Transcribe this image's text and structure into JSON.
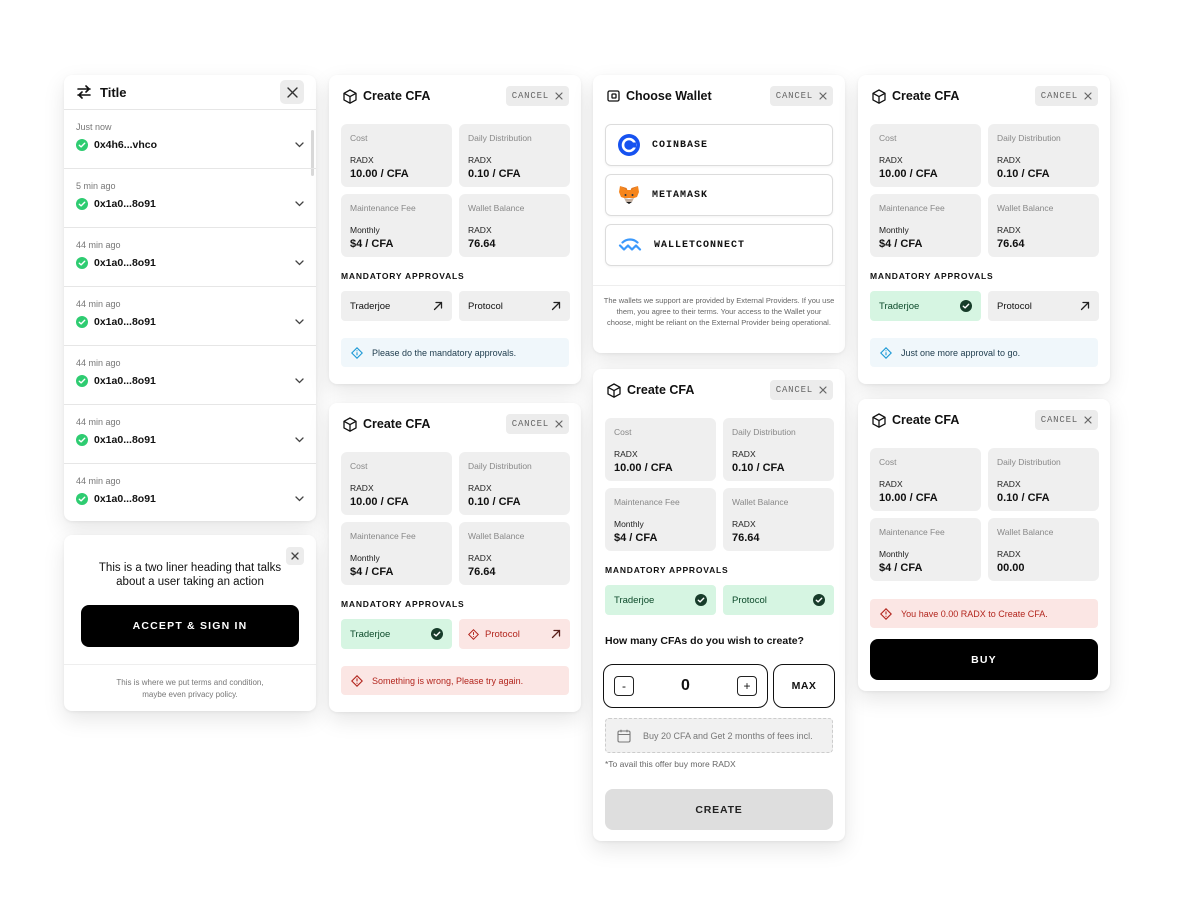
{
  "history": {
    "title": "Title",
    "rows": [
      {
        "time": "Just now",
        "address": "0x4h6...vhco"
      },
      {
        "time": "5 min ago",
        "address": "0x1a0...8o91"
      },
      {
        "time": "44 min ago",
        "address": "0x1a0...8o91"
      },
      {
        "time": "44 min ago",
        "address": "0x1a0...8o91"
      },
      {
        "time": "44 min ago",
        "address": "0x1a0...8o91"
      },
      {
        "time": "44 min ago",
        "address": "0x1a0...8o91"
      },
      {
        "time": "44 min ago",
        "address": "0x1a0...8o91"
      }
    ]
  },
  "sign": {
    "heading": "This is a two liner heading that talks about a user taking an action",
    "button": "ACCEPT & SIGN IN",
    "terms_line1": "This is where we put terms and condition,",
    "terms_line2": "maybe even privacy policy."
  },
  "common": {
    "cfa_title": "Create CFA",
    "cancel": "CANCEL",
    "cost_label": "Cost",
    "daily_label": "Daily Distribution",
    "fee_label": "Maintenance Fee",
    "balance_label": "Wallet Balance",
    "radx": "RADX",
    "monthly": "Monthly",
    "cost_value": "10.00 / CFA",
    "daily_value": "0.10 / CFA",
    "fee_value": "$4 / CFA",
    "balance_value": "76.64",
    "mandatory": "MANDATORY APPROVALS",
    "traderjoe": "Traderjoe",
    "protocol": "Protocol"
  },
  "panel1": {
    "alert": "Please do the mandatory approvals."
  },
  "panel2": {
    "alert": "Something is wrong, Please try again."
  },
  "wallet": {
    "title": "Choose Wallet",
    "cancel": "CANCEL",
    "options": [
      "COINBASE",
      "METAMASK",
      "WALLETCONNECT"
    ],
    "note": "The wallets we support are provided by External Providers. If you use them, you agree to their terms. Your access to the Wallet your choose, might be reliant on the External Provider being operational."
  },
  "create": {
    "question": "How many CFAs do you wish to create?",
    "minus": "-",
    "plus": "+",
    "count": "0",
    "max": "MAX",
    "offer": "Buy 20 CFA and Get 2 months of fees incl.",
    "offer_note": "*To avail this offer buy more RADX",
    "button": "CREATE"
  },
  "panel4": {
    "alert": "Just one more approval to go."
  },
  "panel5": {
    "balance_value": "00.00",
    "alert": "You have 0.00 RADX to Create CFA.",
    "button": "BUY"
  },
  "colors": {
    "success": "#2ecc71",
    "error": "#b3261e",
    "info": "#1f9ad6",
    "coinbase": "#1652f0",
    "walletconnect": "#3b99fc",
    "metamask": "#f6851b"
  }
}
